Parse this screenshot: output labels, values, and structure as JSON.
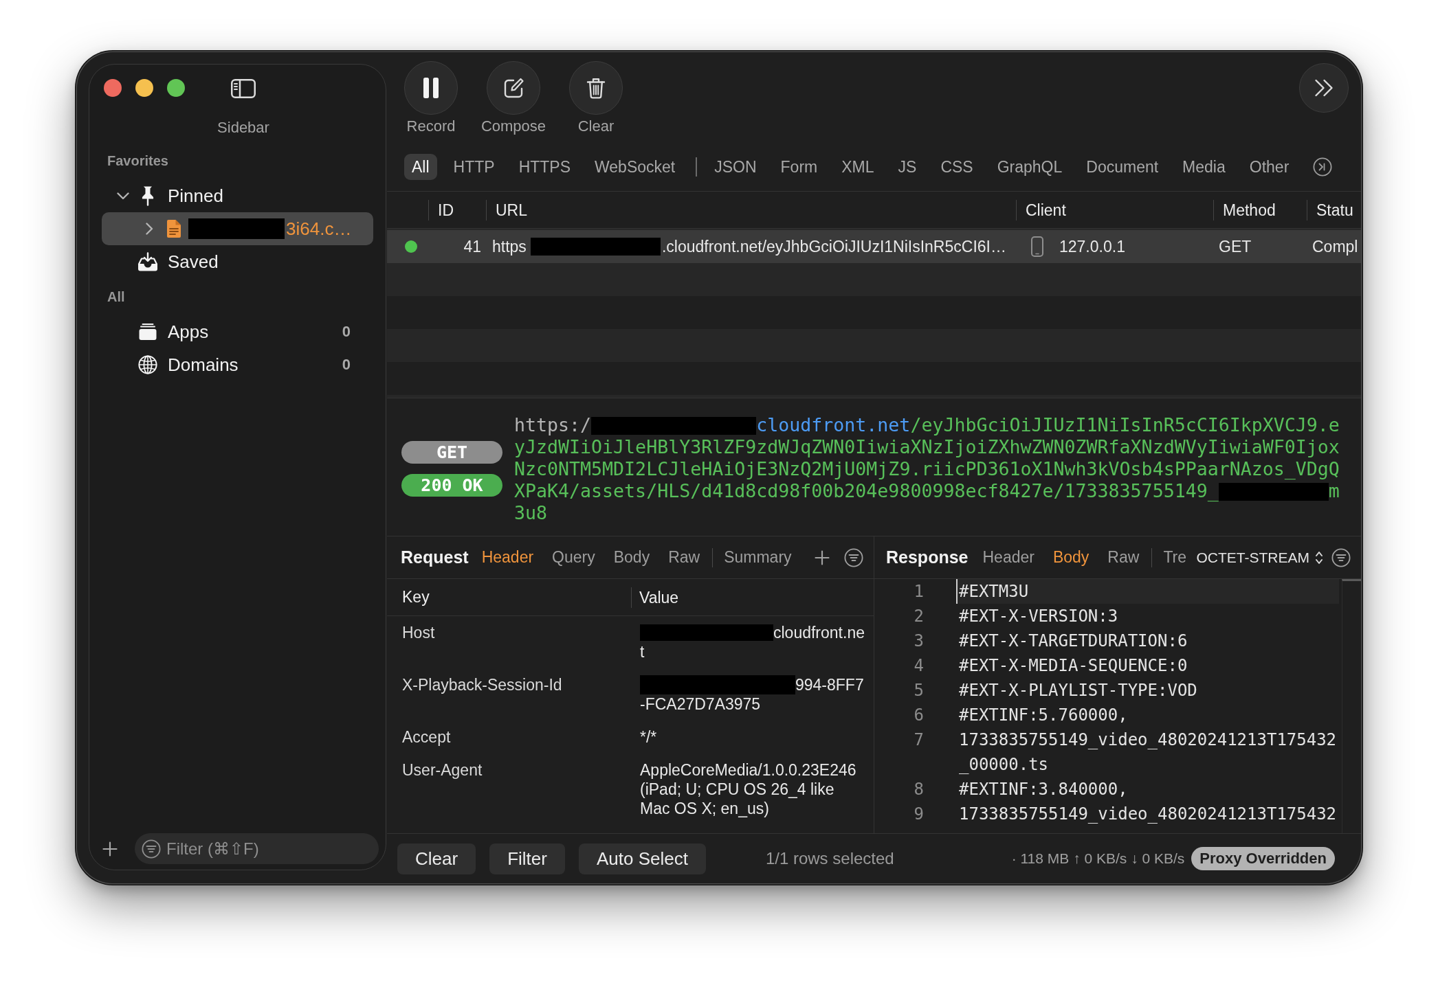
{
  "sidebar": {
    "toggle_label": "Sidebar",
    "sections": [
      {
        "title": "Favorites",
        "items": [
          {
            "label": "Pinned",
            "expanded": true,
            "selected": false,
            "children": [
              {
                "label_parts": [
                  {
                    "kind": "redacted"
                  },
                  {
                    "kind": "text",
                    "text": "3i64.c…"
                  }
                ],
                "expanded": false,
                "selected": true
              }
            ]
          },
          {
            "label": "Saved",
            "selected": false
          }
        ]
      },
      {
        "title": "All",
        "items": [
          {
            "label": "Apps",
            "count": "0",
            "selected": false
          },
          {
            "label": "Domains",
            "count": "0",
            "selected": false
          }
        ]
      }
    ],
    "filter": {
      "placeholder": "Filter (⌘⇧F)"
    }
  },
  "toolbar": {
    "buttons": [
      {
        "label": "Record"
      },
      {
        "label": "Compose"
      },
      {
        "label": "Clear"
      }
    ]
  },
  "filter_tab_groups": [
    {
      "tabs": [
        {
          "label": "All",
          "selected": true
        },
        {
          "label": "HTTP",
          "selected": false
        },
        {
          "label": "HTTPS",
          "selected": false
        },
        {
          "label": "WebSocket",
          "selected": false
        }
      ]
    },
    {
      "tabs": [
        {
          "label": "JSON",
          "selected": false
        },
        {
          "label": "Form",
          "selected": false
        },
        {
          "label": "XML",
          "selected": false
        },
        {
          "label": "JS",
          "selected": false
        },
        {
          "label": "CSS",
          "selected": false
        },
        {
          "label": "GraphQL",
          "selected": false
        },
        {
          "label": "Document",
          "selected": false
        },
        {
          "label": "Media",
          "selected": false
        },
        {
          "label": "Other",
          "selected": false
        }
      ]
    }
  ],
  "table": {
    "columns": [
      {
        "label": "ID"
      },
      {
        "label": "URL"
      },
      {
        "label": "Client"
      },
      {
        "label": "Method"
      },
      {
        "label": "Statu"
      }
    ],
    "rows": [
      {
        "selected": true,
        "color": "#4fc44f",
        "id": "41",
        "url_parts": [
          {
            "kind": "text",
            "text": "https"
          },
          {
            "kind": "redacted"
          },
          {
            "kind": "text",
            "text": ".cloudfront.net/eyJhbGciOiJIUzI1NiIsInR5cCI6I…"
          }
        ],
        "client": "127.0.0.1",
        "method": "GET",
        "status": "Compl"
      }
    ]
  },
  "detail": {
    "method": "GET",
    "status": "200 OK",
    "url_parts": [
      {
        "kind": "scheme",
        "text": "https:/"
      },
      {
        "kind": "redacted"
      },
      {
        "kind": "host",
        "text": "cloudfront.net"
      },
      {
        "kind": "path",
        "text": "/eyJhbGciOiJIUzI1NiIsInR5cCI6IkpXVCJ9.eyJzdWIiOiJleHBlY3RlZF9zdWJqZWN0IiwiaXNzIjoiZXhwZWN0ZWRfaXNzdWVyIiwiaWF0IjoxNzc0NTM5MDI2LCJleHAiOjE3NzQ2MjU0MjZ9.riicPD361oX1Nwh3kVOsb4sPPaarNAzos_VDgQXPaK4/assets/HLS/d41d8cd98f00b204e9800998ecf8427e/1733835755149_"
      },
      {
        "kind": "redacted"
      },
      {
        "kind": "path",
        "text": "m3u8"
      }
    ]
  },
  "request": {
    "title": "Request",
    "tab_groups": [
      {
        "tabs": [
          {
            "label": "Header",
            "selected": true
          },
          {
            "label": "Query",
            "selected": false
          },
          {
            "label": "Body",
            "selected": false
          },
          {
            "label": "Raw",
            "selected": false
          }
        ]
      },
      {
        "tabs": [
          {
            "label": "Summary",
            "selected": false
          }
        ]
      }
    ],
    "columns": [
      {
        "label": "Key"
      },
      {
        "label": "Value"
      }
    ],
    "headers": [
      {
        "key": "Host",
        "value_parts": [
          {
            "kind": "redacted"
          },
          {
            "kind": "text",
            "text": "cloudfront.net"
          }
        ]
      },
      {
        "key": "X-Playback-Session-Id",
        "value_parts": [
          {
            "kind": "redacted"
          },
          {
            "kind": "text",
            "text": "994-8FF7-FCA27D7A3975"
          }
        ]
      },
      {
        "key": "Accept",
        "value": "*/*"
      },
      {
        "key": "User-Agent",
        "value": "AppleCoreMedia/1.0.0.23E246 (iPad; U; CPU OS 26_4 like Mac OS X; en_us)"
      }
    ]
  },
  "response": {
    "title": "Response",
    "tab_groups": [
      {
        "tabs": [
          {
            "label": "Header",
            "selected": false
          },
          {
            "label": "Body",
            "selected": true
          },
          {
            "label": "Raw",
            "selected": false
          }
        ]
      },
      {
        "tabs": [
          {
            "label": "Tre",
            "selected": false
          }
        ]
      }
    ],
    "format": "OCTET-STREAM",
    "lines": [
      {
        "number": "1",
        "text": "#EXTM3U",
        "current": true
      },
      {
        "number": "2",
        "text": "#EXT-X-VERSION:3",
        "current": false
      },
      {
        "number": "3",
        "text": "#EXT-X-TARGETDURATION:6",
        "current": false
      },
      {
        "number": "4",
        "text": "#EXT-X-MEDIA-SEQUENCE:0",
        "current": false
      },
      {
        "number": "5",
        "text": "#EXT-X-PLAYLIST-TYPE:VOD",
        "current": false
      },
      {
        "number": "6",
        "text": "#EXTINF:5.760000,",
        "current": false
      },
      {
        "number": "7",
        "text": "1733835755149_video_48020241213T175432_00000.ts",
        "current": false
      },
      {
        "number": "8",
        "text": "#EXTINF:3.840000,",
        "current": false
      },
      {
        "number": "9",
        "text": "1733835755149_video_48020241213T175432",
        "current": false
      }
    ]
  },
  "bottom_bar": {
    "buttons": [
      {
        "label": "Clear"
      },
      {
        "label": "Filter"
      },
      {
        "label": "Auto Select"
      }
    ],
    "selection": "1/1 rows selected",
    "stats": "· 118 MB ↑ 0 KB/s ↓ 0 KB/s",
    "proxy_badge": "Proxy Overridden"
  }
}
